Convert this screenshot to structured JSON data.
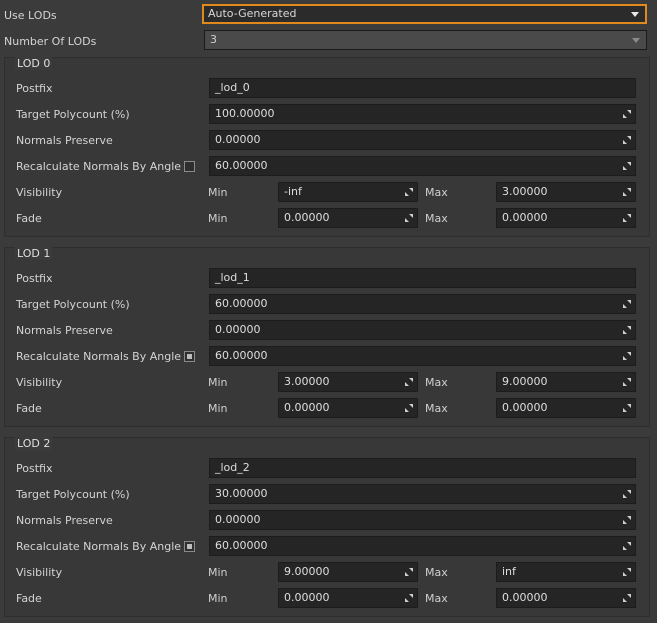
{
  "use_lods": {
    "label": "Use LODs",
    "value": "Auto-Generated"
  },
  "number_of_lods": {
    "label": "Number Of LODs",
    "value": "3"
  },
  "row_labels": {
    "postfix": "Postfix",
    "target_polycount": "Target Polycount (%)",
    "normals_preserve": "Normals Preserve",
    "recalculate_normals": "Recalculate Normals By Angle",
    "visibility": "Visibility",
    "fade": "Fade",
    "min": "Min",
    "max": "Max"
  },
  "lods": [
    {
      "title": "LOD 0",
      "postfix": "_lod_0",
      "target_polycount": "100.00000",
      "normals_preserve": "0.00000",
      "recalculate_checked": false,
      "recalculate_angle": "60.00000",
      "visibility_min": "-inf",
      "visibility_max": "3.00000",
      "fade_min": "0.00000",
      "fade_max": "0.00000"
    },
    {
      "title": "LOD 1",
      "postfix": "_lod_1",
      "target_polycount": "60.00000",
      "normals_preserve": "0.00000",
      "recalculate_checked": true,
      "recalculate_angle": "60.00000",
      "visibility_min": "3.00000",
      "visibility_max": "9.00000",
      "fade_min": "0.00000",
      "fade_max": "0.00000"
    },
    {
      "title": "LOD 2",
      "postfix": "_lod_2",
      "target_polycount": "30.00000",
      "normals_preserve": "0.00000",
      "recalculate_checked": true,
      "recalculate_angle": "60.00000",
      "visibility_min": "9.00000",
      "visibility_max": "inf",
      "fade_min": "0.00000",
      "fade_max": "0.00000"
    }
  ],
  "colors": {
    "accent": "#e08a1e",
    "background": "#3b3b3b",
    "field": "#252525"
  },
  "icons": {
    "dropdown": "chevron-down-icon",
    "spinner": "drag-spin-icon"
  }
}
